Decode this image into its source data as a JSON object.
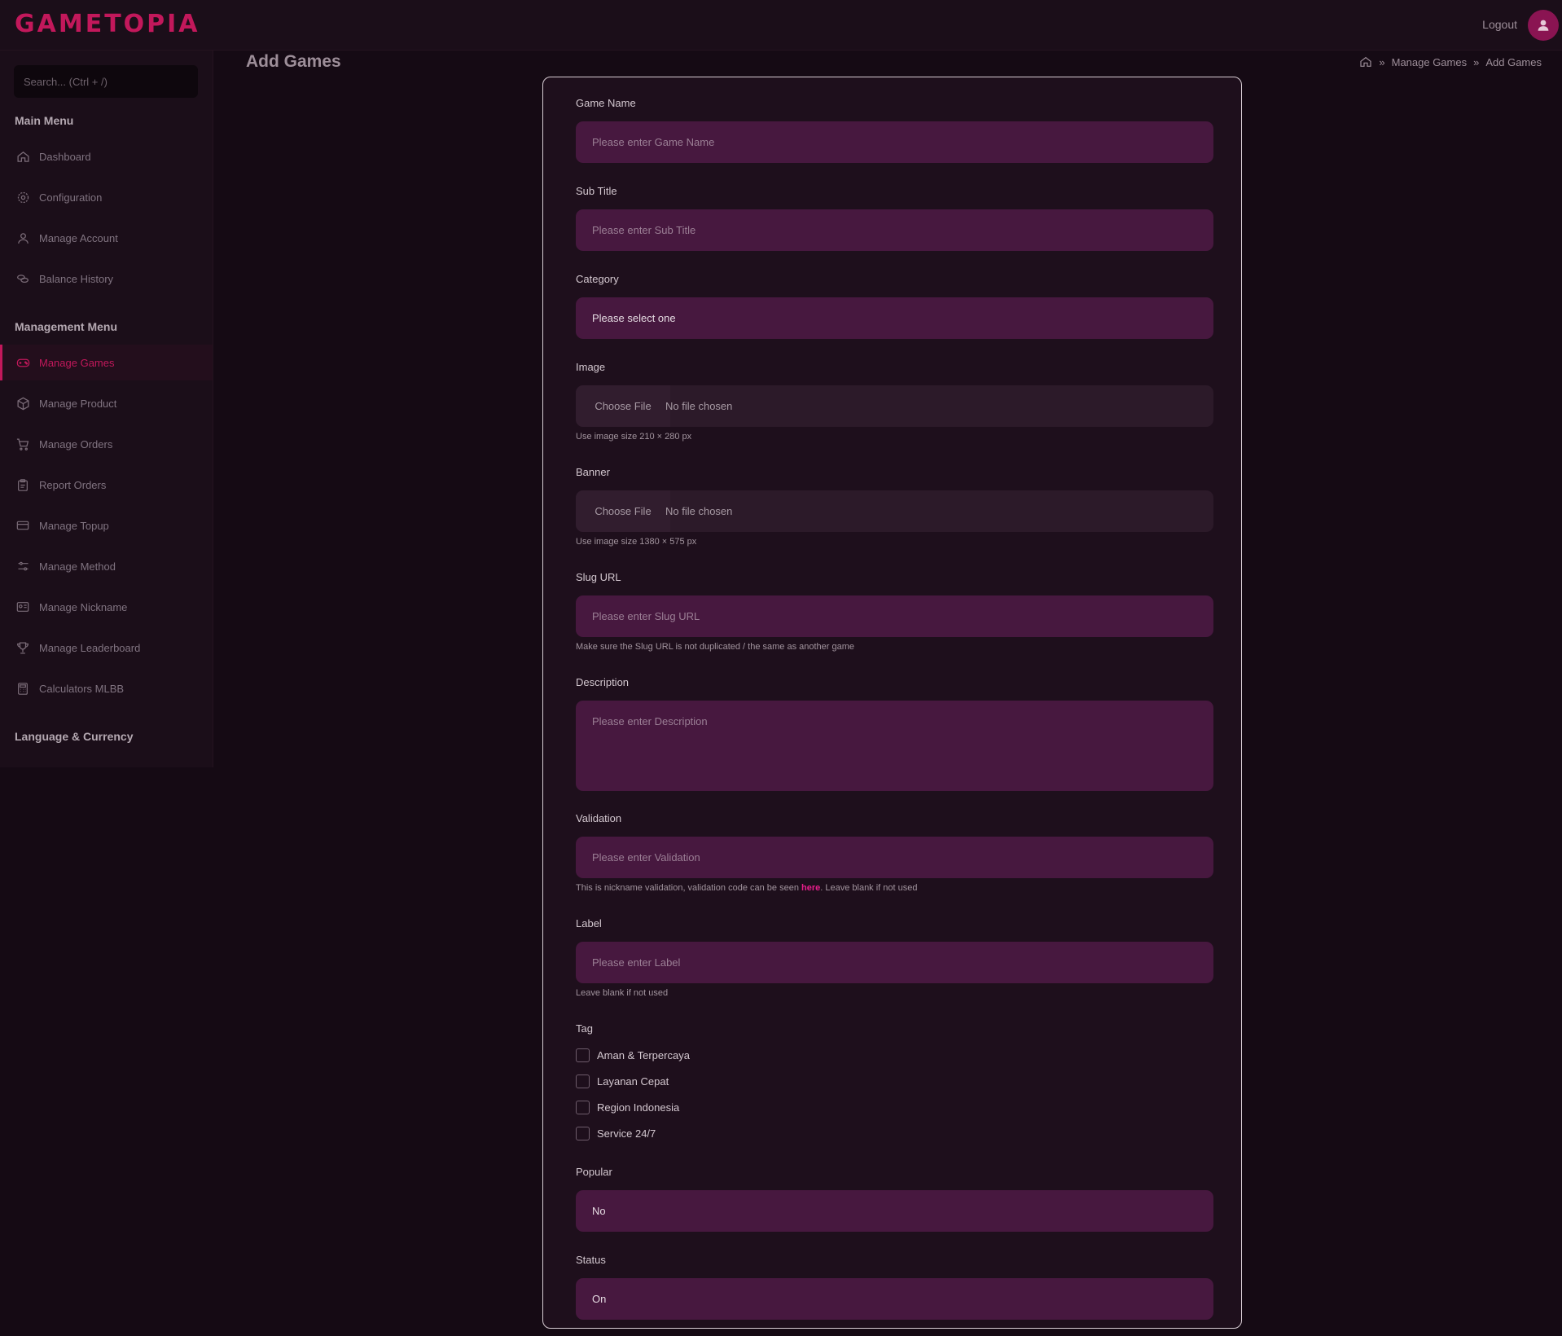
{
  "app": {
    "logo": "GAMETOPIA",
    "logout_label": "Logout",
    "brand_color": "#c2185b"
  },
  "sidebar": {
    "search_placeholder": "Search... (Ctrl + /)",
    "main_heading": "Main Menu",
    "main_items": [
      {
        "label": "Dashboard",
        "icon": "home-icon"
      },
      {
        "label": "Configuration",
        "icon": "gear-icon"
      },
      {
        "label": "Manage Account",
        "icon": "user-icon"
      },
      {
        "label": "Balance History",
        "icon": "coins-icon"
      }
    ],
    "management_heading": "Management Menu",
    "management_items": [
      {
        "label": "Manage Games",
        "icon": "gamepad-icon",
        "active": true
      },
      {
        "label": "Manage Product",
        "icon": "box-icon"
      },
      {
        "label": "Manage Orders",
        "icon": "cart-icon"
      },
      {
        "label": "Report Orders",
        "icon": "clipboard-icon"
      },
      {
        "label": "Manage Topup",
        "icon": "card-icon"
      },
      {
        "label": "Manage Method",
        "icon": "sliders-icon"
      },
      {
        "label": "Manage Nickname",
        "icon": "id-card-icon"
      },
      {
        "label": "Manage Leaderboard",
        "icon": "trophy-icon"
      },
      {
        "label": "Calculators MLBB",
        "icon": "calculator-icon"
      }
    ],
    "language_heading": "Language & Currency"
  },
  "header": {
    "title": "Add Games",
    "breadcrumb": [
      "Manage Games",
      "Add Games"
    ]
  },
  "form": {
    "game_name": {
      "label": "Game Name",
      "placeholder": "Please enter Game Name"
    },
    "sub_title": {
      "label": "Sub Title",
      "placeholder": "Please enter Sub Title"
    },
    "category": {
      "label": "Category",
      "value": "Please select one"
    },
    "image": {
      "label": "Image",
      "button": "Choose File",
      "status": "No file chosen",
      "help": "Use image size 210 × 280 px"
    },
    "banner": {
      "label": "Banner",
      "button": "Choose File",
      "status": "No file chosen",
      "help": "Use image size 1380 × 575 px"
    },
    "slug": {
      "label": "Slug URL",
      "placeholder": "Please enter Slug URL",
      "help": "Make sure the Slug URL is not duplicated / the same as another game"
    },
    "description": {
      "label": "Description",
      "placeholder": "Please enter Description"
    },
    "validation": {
      "label": "Validation",
      "placeholder": "Please enter Validation",
      "help_before": "This is nickname validation, validation code can be seen ",
      "help_link": "here",
      "help_after": ". Leave blank if not used"
    },
    "label_field": {
      "label": "Label",
      "placeholder": "Please enter Label",
      "help": "Leave blank if not used"
    },
    "tag": {
      "label": "Tag",
      "options": [
        "Aman & Terpercaya",
        "Layanan Cepat",
        "Region Indonesia",
        "Service 24/7"
      ]
    },
    "popular": {
      "label": "Popular",
      "value": "No"
    },
    "status": {
      "label": "Status",
      "value": "On"
    }
  }
}
